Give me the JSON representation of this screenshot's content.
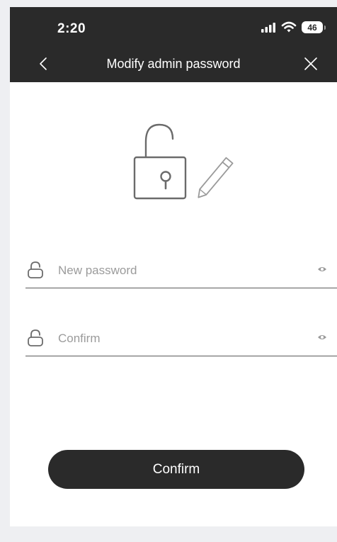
{
  "status_bar": {
    "time": "2:20",
    "battery": "46"
  },
  "header": {
    "title": "Modify admin password",
    "back_icon": "chevron-left-icon",
    "close_icon": "close-icon"
  },
  "hero": {
    "icon": "unlocked-padlock-with-pencil-icon"
  },
  "form": {
    "new_password": {
      "placeholder": "New password",
      "value": ""
    },
    "confirm_password": {
      "placeholder": "Confirm",
      "value": ""
    }
  },
  "actions": {
    "confirm_label": "Confirm"
  },
  "colors": {
    "header_bg": "#2a2a2a",
    "button_bg": "#2a2a2a",
    "page_bg": "#ffffff",
    "outer_bg": "#eeeff2",
    "placeholder": "#9b9b9b",
    "icon_gray": "#6b6b6b"
  }
}
